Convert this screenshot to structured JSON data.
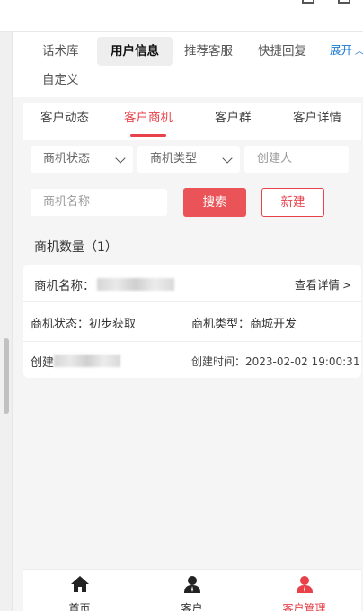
{
  "tool_tabs": [
    {
      "label": "话术库"
    },
    {
      "label": "用户信息"
    },
    {
      "label": "推荐客服"
    },
    {
      "label": "快捷回复"
    },
    {
      "label": "自定义"
    }
  ],
  "expand_label": "展开",
  "sub_tabs": [
    {
      "label": "客户动态"
    },
    {
      "label": "客户商机"
    },
    {
      "label": "客户群"
    },
    {
      "label": "客户详情"
    }
  ],
  "filters": {
    "status_placeholder": "商机状态",
    "type_placeholder": "商机类型",
    "creator_placeholder": "创建人",
    "name_placeholder": "商机名称"
  },
  "buttons": {
    "search": "搜索",
    "new": "新建"
  },
  "count_label": "商机数量（1）",
  "card": {
    "name_label": "商机名称：",
    "detail_link": "查看详情",
    "status_label": "商机状态：初步获取",
    "type_label": "商机类型：商城开发",
    "creator_label": "创建",
    "created_time": "创建时间：2023-02-02 19:00:31"
  },
  "bottom_nav": [
    {
      "label": "首页",
      "icon": "home-icon"
    },
    {
      "label": "客户",
      "icon": "person-icon"
    },
    {
      "label": "客户管理",
      "icon": "person-manage-icon"
    }
  ],
  "colors": {
    "accent": "#e8414a",
    "link": "#1677d2",
    "search_button": "#ea5357"
  }
}
